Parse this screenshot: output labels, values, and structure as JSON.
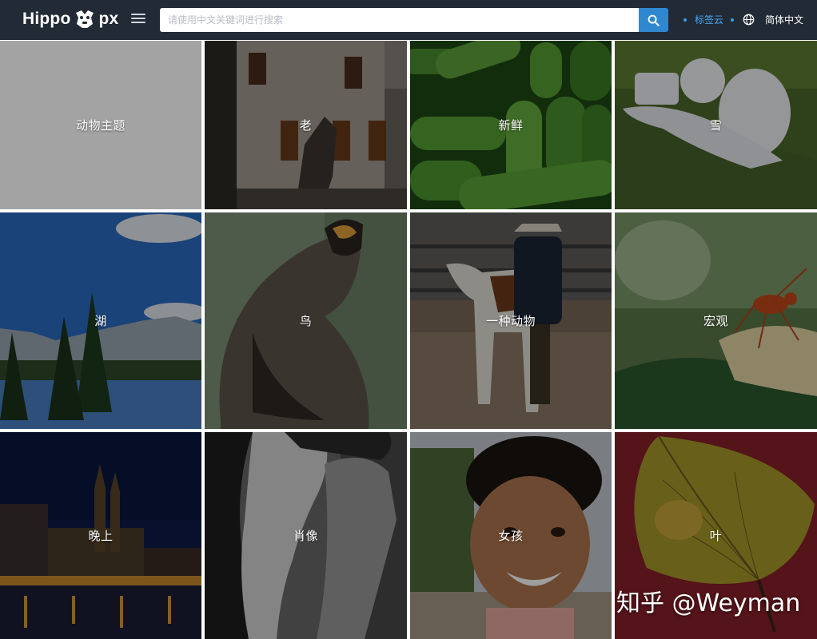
{
  "header": {
    "brand_left": "Hippo",
    "brand_right": "px",
    "search_placeholder": "请使用中文关键词进行搜索",
    "nav_tags_label": "标签云",
    "language_label": "简体中文"
  },
  "icons": {
    "menu": "hamburger-icon",
    "search": "search-icon",
    "globe": "globe-icon",
    "logo": "hippo-logo-icon"
  },
  "colors": {
    "topbar": "#222a36",
    "search_button": "#2f87cf",
    "tag_link": "#4aa8f0"
  },
  "categories": [
    {
      "label": "动物主题"
    },
    {
      "label": "老"
    },
    {
      "label": "新鲜"
    },
    {
      "label": "雪"
    },
    {
      "label": "湖"
    },
    {
      "label": "鸟"
    },
    {
      "label": "一种动物"
    },
    {
      "label": "宏观"
    },
    {
      "label": "晚上"
    },
    {
      "label": "肖像"
    },
    {
      "label": "女孩"
    },
    {
      "label": "叶"
    }
  ],
  "watermark": "知乎 @Weyman"
}
